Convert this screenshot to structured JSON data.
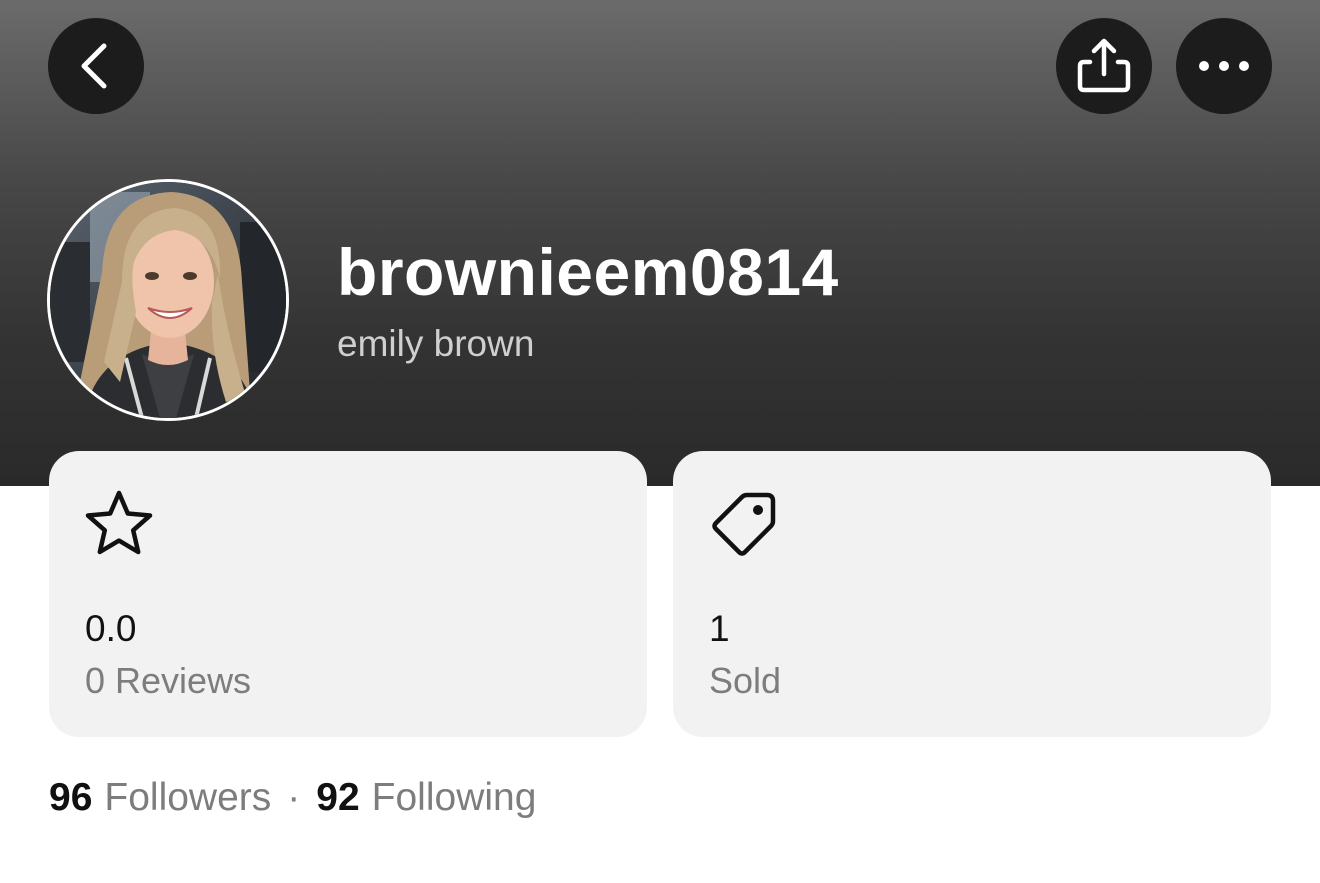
{
  "header": {
    "back_icon": "chevron-left-icon",
    "share_icon": "share-icon",
    "more_icon": "more-horizontal-icon"
  },
  "profile": {
    "username": "brownieem0814",
    "full_name": "emily brown",
    "avatar": "profile-photo"
  },
  "stats": {
    "rating": {
      "icon": "star-icon",
      "value": "0.0",
      "label": "0 Reviews"
    },
    "sold": {
      "icon": "tag-icon",
      "value": "1",
      "label": "Sold"
    }
  },
  "social": {
    "followers_count": "96",
    "followers_label": "Followers",
    "separator": "·",
    "following_count": "92",
    "following_label": "Following"
  },
  "colors": {
    "header_top": "#6b6b6b",
    "header_bottom": "#2a2a2a",
    "button_bg": "#1c1c1c",
    "card_bg": "#f2f2f2",
    "muted_text": "#7d7d7d"
  }
}
